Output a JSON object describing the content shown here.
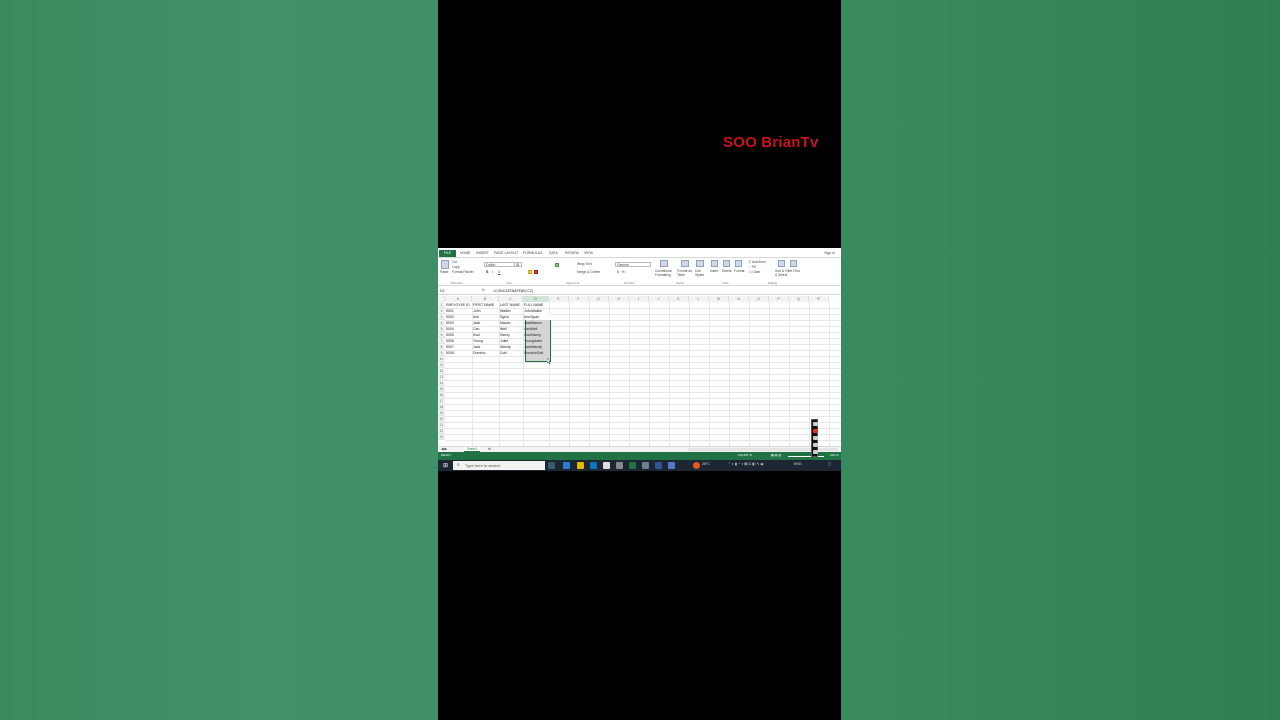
{
  "watermark": "SOO BrianTv",
  "excel": {
    "file_tab": "FILE",
    "tabs": [
      "HOME",
      "INSERT",
      "PAGE LAYOUT",
      "FORMULAS",
      "DATA",
      "REVIEW",
      "VIEW"
    ],
    "sign_in": "Sign in",
    "ribbon": {
      "cut": "Cut",
      "copy": "Copy",
      "format_painter": "Format Painter",
      "paste": "Paste",
      "font_name": "Calibri",
      "font_size": "11",
      "wrap_text": "Wrap Text",
      "merge_center": "Merge & Center",
      "number_format": "General",
      "conditional_formatting": "Conditional Formatting",
      "format_as_table": "Format as Table",
      "cell_styles": "Cell Styles",
      "insert": "Insert",
      "delete": "Delete",
      "format": "Format",
      "autosum": "AutoSum",
      "fill": "Fill",
      "clear": "Clear",
      "sort_filter": "Sort & Filter",
      "find_select": "Find & Select",
      "groups": [
        "Clipboard",
        "Font",
        "Alignment",
        "Number",
        "Styles",
        "Cells",
        "Editing"
      ]
    },
    "name_box": "D3",
    "formula_fx": "fx",
    "formula": "=CONCATENATE(B2,C2)",
    "columns": [
      "A",
      "B",
      "C",
      "D",
      "E",
      "F",
      "G",
      "H",
      "I",
      "J",
      "K",
      "L",
      "M",
      "N",
      "O",
      "P",
      "Q",
      "R"
    ],
    "header_row": [
      "EMPLOYEE ID",
      "FIRST NAME",
      "LAST NAME",
      "FULL NAME"
    ],
    "rows": [
      [
        "5001",
        "John",
        "Walker",
        "JohnWalker"
      ],
      [
        "5002",
        "Ann",
        "Sgulu",
        "AnnSgulu"
      ],
      [
        "5003",
        "Jack",
        "Mason",
        "JackMason"
      ],
      [
        "5004",
        "Can",
        "Well",
        "CanWell"
      ],
      [
        "5005",
        "Soul",
        "Sanny",
        "SoulSanny"
      ],
      [
        "5006",
        "Young",
        "Jules",
        "YoungJules"
      ],
      [
        "5007",
        "Jack",
        "Wendy",
        "JackWendy"
      ],
      [
        "5008",
        "Dominic",
        "Gob'",
        "DominicGob'"
      ]
    ],
    "row_numbers": [
      "1",
      "2",
      "3",
      "4",
      "5",
      "6",
      "7",
      "8",
      "9",
      "10",
      "11",
      "12",
      "13",
      "14",
      "15",
      "16",
      "17",
      "18",
      "19",
      "20",
      "21",
      "22",
      "23"
    ],
    "sheet_tab": "Sheet1",
    "status_left": "READY",
    "status_count": "COUNT: 8",
    "zoom": "100 %"
  },
  "taskbar": {
    "search_placeholder": "Type here to search",
    "weather": "26°C",
    "language": "ENG"
  },
  "colors": {
    "excel_green": "#217346",
    "watermark_red": "#c8141a",
    "background_green": "#3f8e64"
  }
}
